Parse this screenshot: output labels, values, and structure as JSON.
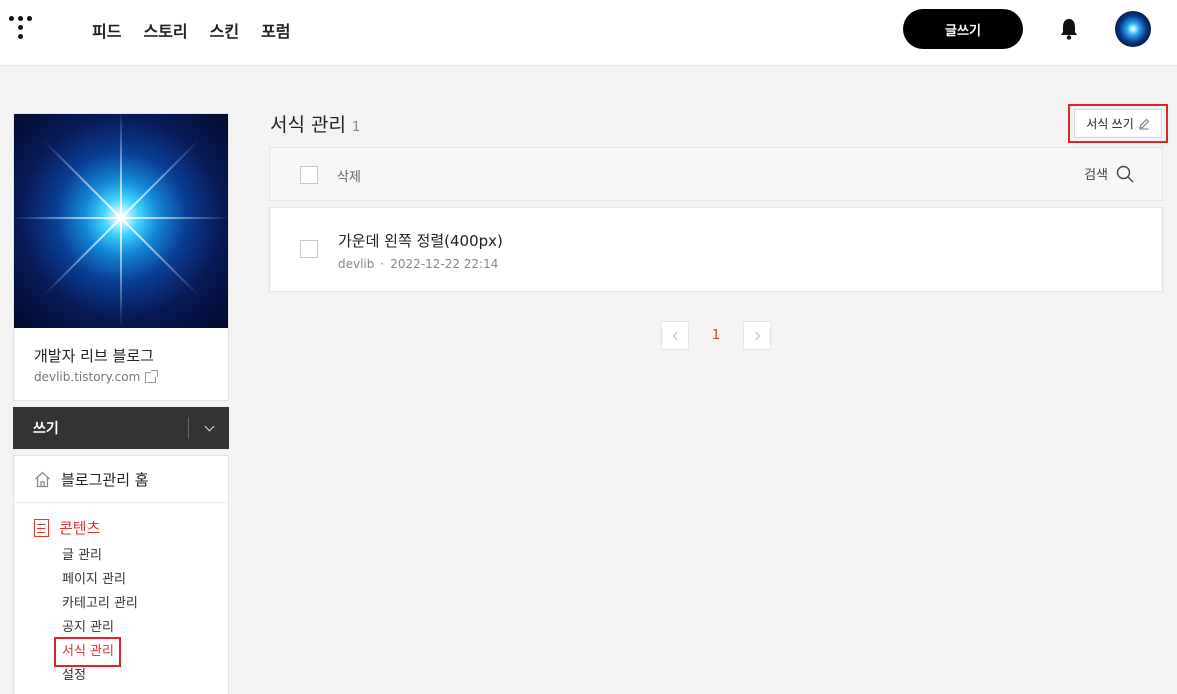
{
  "header": {
    "nav": [
      "피드",
      "스토리",
      "스킨",
      "포럼"
    ],
    "write_button": "글쓰기"
  },
  "sidebar": {
    "blog_name": "개발자 리브 블로그",
    "blog_url": "devlib.tistory.com",
    "write_label": "쓰기",
    "home_label": "블로그관리 홈",
    "section_title": "콘텐츠",
    "items": [
      "글 관리",
      "페이지 관리",
      "카테고리 관리",
      "공지 관리",
      "서식 관리",
      "설정"
    ],
    "active_item": "서식 관리"
  },
  "main": {
    "title": "서식 관리",
    "count": "1",
    "new_button": "서식 쓰기",
    "delete_label": "삭제",
    "search_label": "검색",
    "items": [
      {
        "title": "가운데 왼쪽 정렬(400px)",
        "author": "devlib",
        "date": "2022-12-22 22:14"
      }
    ]
  },
  "pagination": {
    "current": "1"
  },
  "colors": {
    "accent": "#e0342f",
    "highlight_box": "#e0242a",
    "dark": "#333333"
  }
}
